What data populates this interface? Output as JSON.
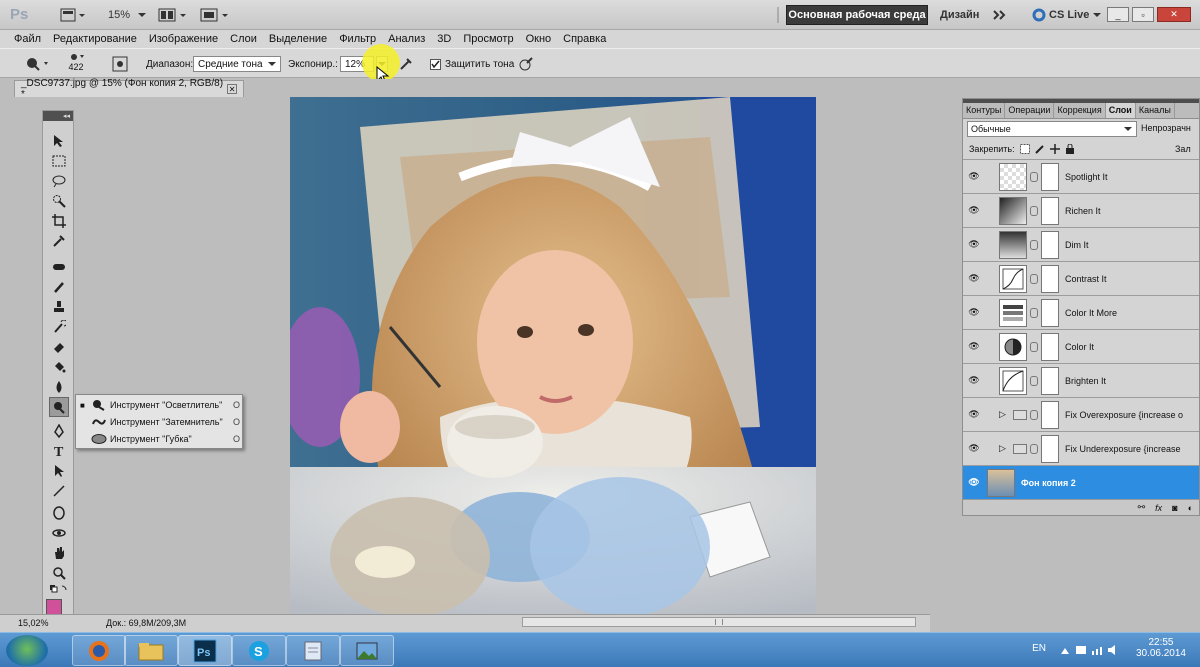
{
  "appbar": {
    "logo": "Ps",
    "zoom": "15%",
    "workspace_active": "Основная рабочая среда",
    "workspace_design": "Дизайн",
    "cslive": "CS Live"
  },
  "menu": [
    "Файл",
    "Редактирование",
    "Изображение",
    "Слои",
    "Выделение",
    "Фильтр",
    "Анализ",
    "3D",
    "Просмотр",
    "Окно",
    "Справка"
  ],
  "options": {
    "brush_size": "422",
    "range_label": "Диапазон:",
    "range_value": "Средние тона",
    "exposure_label": "Экспонир.:",
    "exposure_value": "12%",
    "protect_label": "Защитить тона"
  },
  "document": {
    "tab_title": "_DSC9737.jpg @ 15% (Фон копия 2, RGB/8) *"
  },
  "flyout": [
    {
      "label": "Инструмент \"Осветлитель\"",
      "key": "O",
      "selected": true
    },
    {
      "label": "Инструмент \"Затемнитель\"",
      "key": "O",
      "selected": false
    },
    {
      "label": "Инструмент \"Губка\"",
      "key": "O",
      "selected": false
    }
  ],
  "status": {
    "zoom": "15,02%",
    "doc": "Док.: 69,8M/209,3M"
  },
  "layers_panel": {
    "tabs": [
      "Контуры",
      "Операции",
      "Коррекция",
      "Слои",
      "Каналы"
    ],
    "active_tab": "Слои",
    "blend_mode": "Обычные",
    "opacity_label": "Непрозрачн",
    "lock_label": "Закрепить:",
    "fill_label": "Зал",
    "layers": [
      {
        "name": "Spotlight It",
        "type": "adjust"
      },
      {
        "name": "Richen It",
        "type": "adjust"
      },
      {
        "name": "Dim It",
        "type": "adjust"
      },
      {
        "name": "Contrast It",
        "type": "adjust"
      },
      {
        "name": "Color It More",
        "type": "adjust"
      },
      {
        "name": "Color It",
        "type": "adjust"
      },
      {
        "name": "Brighten It",
        "type": "adjust"
      },
      {
        "name": "Fix Overexposure {increase o",
        "type": "group"
      },
      {
        "name": "Fix Underexposure {increase",
        "type": "group"
      },
      {
        "name": "Фон копия 2",
        "type": "image",
        "selected": true
      }
    ]
  },
  "taskbar": {
    "lang": "EN",
    "time": "22:55",
    "date": "30.06.2014"
  },
  "colors": {
    "foreground": "#d0509a",
    "background": "#ffffff",
    "selection": "#2d8de0"
  }
}
